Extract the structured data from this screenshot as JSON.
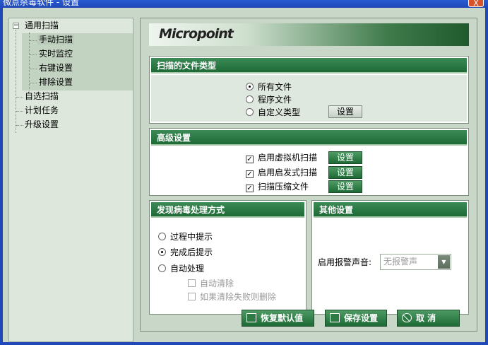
{
  "window": {
    "title": "微点杀毒软件 - 设置",
    "close_label": "X"
  },
  "sidebar": {
    "items": [
      {
        "label": "通用扫描",
        "expanded": true
      },
      {
        "label": "手动扫描",
        "selected": true
      },
      {
        "label": "实时监控"
      },
      {
        "label": "右键设置"
      },
      {
        "label": "排除设置"
      },
      {
        "label": "自选扫描"
      },
      {
        "label": "计划任务"
      },
      {
        "label": "升级设置"
      }
    ],
    "toggle_symbol": "−"
  },
  "banner": {
    "logo_text": "Micropoint"
  },
  "file_types": {
    "title": "扫描的文件类型",
    "options": [
      "所有文件",
      "程序文件",
      "自定义类型"
    ],
    "selected_index": 0,
    "settings_button": "设置"
  },
  "advanced": {
    "title": "高级设置",
    "items": [
      {
        "label": "启用虚拟机扫描",
        "checked": true,
        "button": "设置"
      },
      {
        "label": "启用启发式扫描",
        "checked": true,
        "button": "设置"
      },
      {
        "label": "扫描压缩文件",
        "checked": true,
        "button": "设置"
      }
    ],
    "check_mark": "✓"
  },
  "virus_handling": {
    "title": "发现病毒处理方式",
    "options": [
      "过程中提示",
      "完成后提示",
      "自动处理"
    ],
    "selected_index": 1,
    "sub_options": [
      {
        "label": "自动清除",
        "checked": false,
        "disabled": true
      },
      {
        "label": "如果清除失败则删除",
        "checked": false,
        "disabled": true
      }
    ]
  },
  "other": {
    "title": "其他设置",
    "alarm_label": "启用报警声音:",
    "alarm_value": "无报警声",
    "dropdown_arrow": "▼"
  },
  "footer": {
    "restore_label": "恢复默认值",
    "save_label": "保存设置",
    "cancel_label": "取  消"
  },
  "colors": {
    "accent_green": "#1d6a36",
    "window_bg": "#c9d7c8",
    "title_blue": "#1f48b8"
  }
}
